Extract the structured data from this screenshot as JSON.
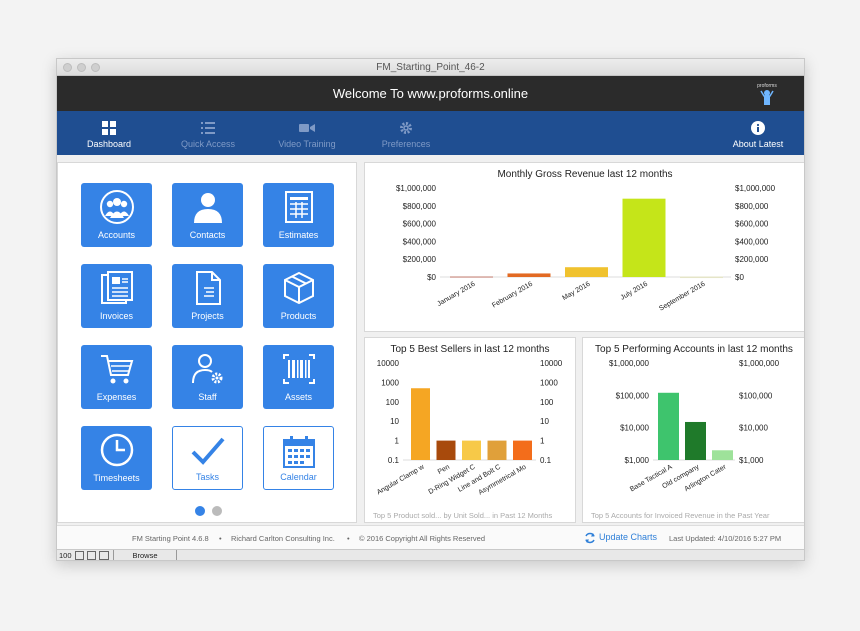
{
  "window": {
    "title": "FM_Starting_Point_46-2"
  },
  "banner": {
    "title": "Welcome To www.proforms.online",
    "logo_text": "proforms"
  },
  "nav": {
    "items": [
      {
        "label": "Dashboard",
        "icon": "grid-icon",
        "active": true
      },
      {
        "label": "Quick Access",
        "icon": "list-icon",
        "active": false
      },
      {
        "label": "Video Training",
        "icon": "video-camera-icon",
        "active": false
      },
      {
        "label": "Preferences",
        "icon": "gear-icon",
        "active": false
      },
      {
        "label": "About Latest",
        "icon": "info-icon",
        "active": true
      }
    ]
  },
  "tiles": [
    {
      "label": "Accounts",
      "icon": "group-icon"
    },
    {
      "label": "Contacts",
      "icon": "person-icon"
    },
    {
      "label": "Estimates",
      "icon": "spreadsheet-icon"
    },
    {
      "label": "Invoices",
      "icon": "documents-icon"
    },
    {
      "label": "Projects",
      "icon": "document-icon"
    },
    {
      "label": "Products",
      "icon": "box-icon"
    },
    {
      "label": "Expenses",
      "icon": "cart-icon"
    },
    {
      "label": "Staff",
      "icon": "person-gear-icon"
    },
    {
      "label": "Assets",
      "icon": "barcode-icon"
    },
    {
      "label": "Timesheets",
      "icon": "clock-icon"
    },
    {
      "label": "Tasks",
      "icon": "checkmark-icon"
    },
    {
      "label": "Calendar",
      "icon": "calendar-icon"
    }
  ],
  "pager": {
    "pages": 2,
    "current": 1
  },
  "chart_data": [
    {
      "type": "bar",
      "title": "Monthly Gross Revenue last 12 months",
      "categories": [
        "January 2016",
        "February 2016",
        "May 2016",
        "July 2016",
        "September 2016"
      ],
      "values": [
        8000,
        40000,
        110000,
        880000,
        5000
      ],
      "colors": [
        "#d4a39a",
        "#e26a23",
        "#f0c22e",
        "#c5e519",
        "#e5e5c8"
      ],
      "yticks": [
        "$1,000,000",
        "$800,000",
        "$600,000",
        "$400,000",
        "$200,000",
        "$0"
      ],
      "ylim": [
        0,
        1000000
      ],
      "scale": "linear",
      "grid": false,
      "footer": ""
    },
    {
      "type": "bar",
      "title": "Top 5 Best Sellers in last 12 months",
      "categories": [
        "Angular Clamp w",
        "Pen",
        "D-Ring Widget C",
        "Line and Bolt C",
        "Asymmetrical Mo"
      ],
      "values": [
        500,
        1,
        1,
        1,
        1
      ],
      "colors": [
        "#f5a623",
        "#a84a0c",
        "#f7c948",
        "#e0a03a",
        "#f36d1b"
      ],
      "yticks": [
        "10000",
        "1000",
        "100",
        "10",
        "1",
        "0.1"
      ],
      "ylim": [
        0.1,
        10000
      ],
      "scale": "log",
      "grid": false,
      "footer": "Top 5 Product sold... by Unit Sold... in Past 12 Months"
    },
    {
      "type": "bar",
      "title": "Top 5 Performing Accounts in last 12 months",
      "categories": [
        "Base Tactical A",
        "Old company",
        "Arlington Cater"
      ],
      "values": [
        120000,
        15000,
        2000
      ],
      "colors": [
        "#3ec46d",
        "#1f7a2a",
        "#9ee29a"
      ],
      "yticks": [
        "$1,000,000",
        "$100,000",
        "$10,000",
        "$1,000"
      ],
      "ylim": [
        1000,
        1000000
      ],
      "scale": "log",
      "grid": false,
      "footer": "Top 5 Accounts for Invoiced Revenue in the Past Year"
    }
  ],
  "footer": {
    "version": "FM Starting Point 4.6.8",
    "sep1": "•",
    "company": "Richard Carlton Consulting Inc.",
    "sep2": "•",
    "copyright": "© 2016 Copyright All Rights Reserved",
    "update_label": "Update Charts",
    "last_updated": "Last Updated: 4/10/2016 5:27 PM"
  },
  "statusbar": {
    "zoom": "100",
    "mode": "Browse"
  }
}
